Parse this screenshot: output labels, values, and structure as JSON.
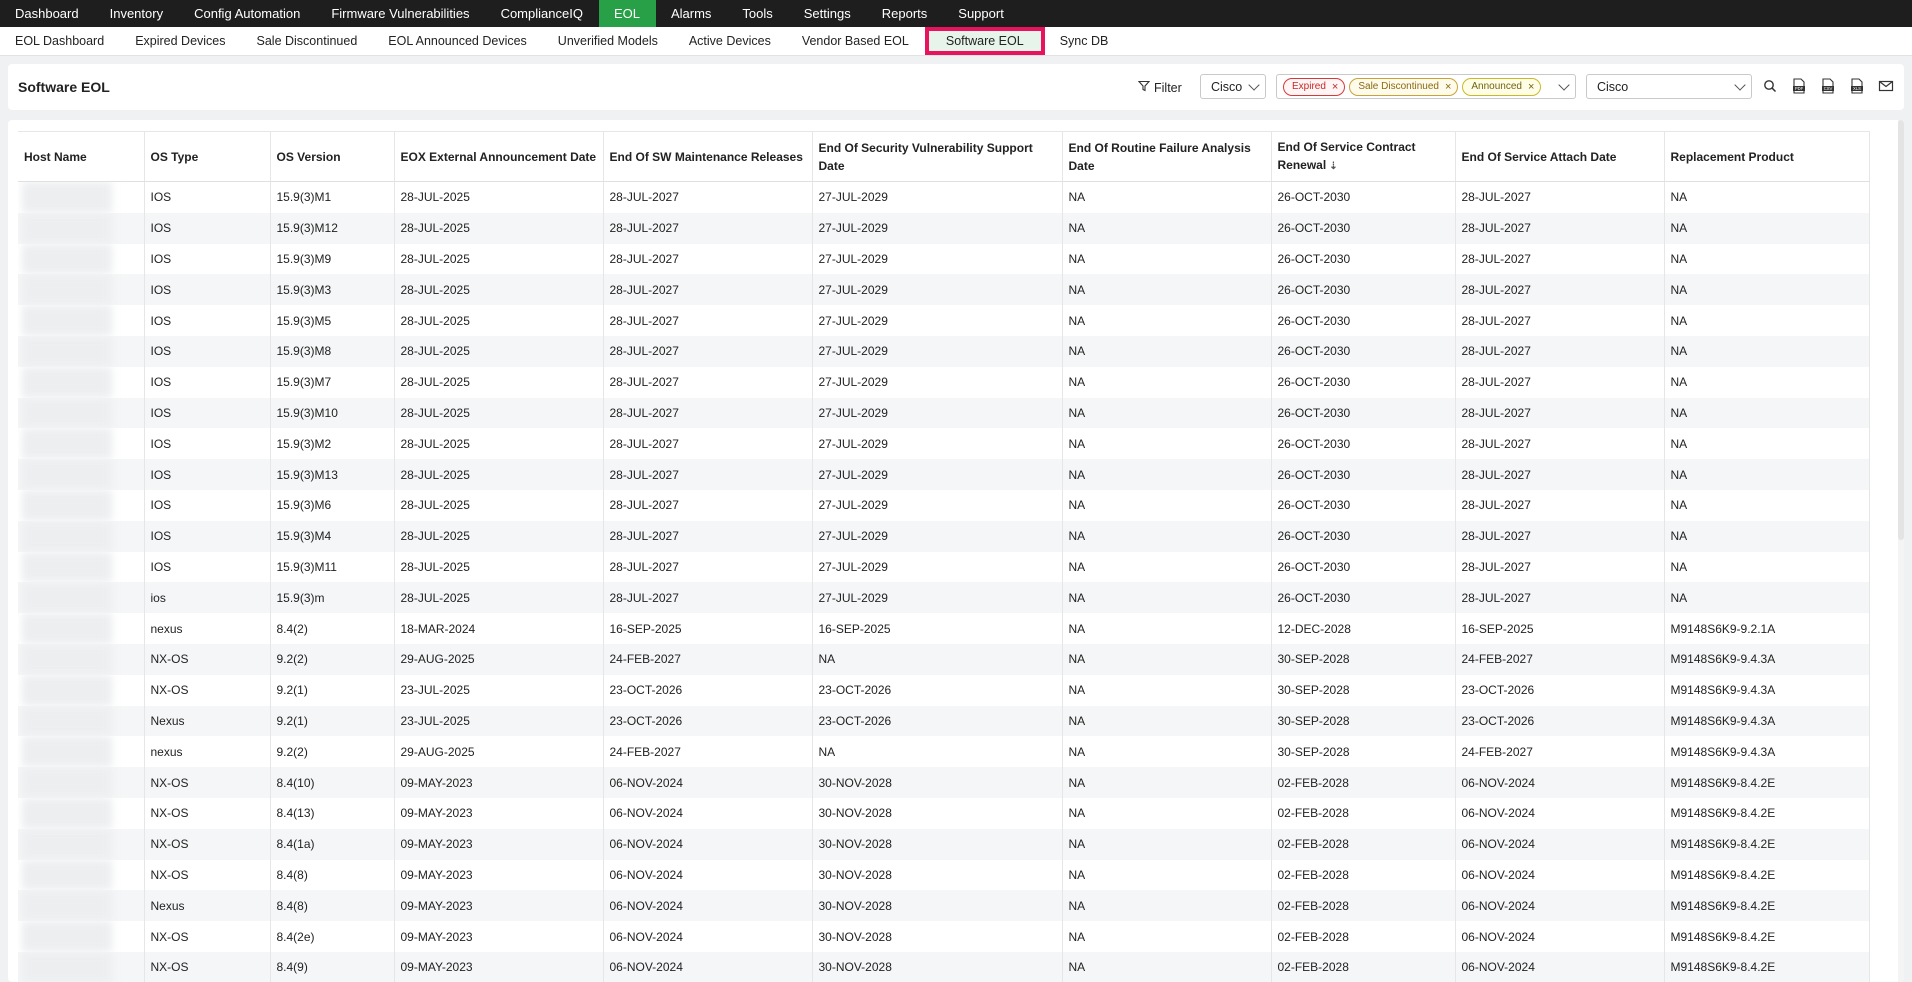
{
  "topnav": {
    "items": [
      "Dashboard",
      "Inventory",
      "Config Automation",
      "Firmware Vulnerabilities",
      "ComplianceIQ",
      "EOL",
      "Alarms",
      "Tools",
      "Settings",
      "Reports",
      "Support"
    ],
    "active": "EOL"
  },
  "subnav": {
    "items": [
      "EOL Dashboard",
      "Expired Devices",
      "Sale Discontinued",
      "EOL Announced Devices",
      "Unverified Models",
      "Active Devices",
      "Vendor Based EOL",
      "Software EOL",
      "Sync DB"
    ],
    "active": "Software EOL"
  },
  "toolbar": {
    "title": "Software EOL",
    "filter_label": "Filter",
    "vendor_value": "Cisco",
    "status_chips": [
      {
        "label": "Expired",
        "color": "#d33b3b"
      },
      {
        "label": "Sale Discontinued",
        "color": "#c9a23a"
      },
      {
        "label": "Announced",
        "color": "#c9b92a"
      }
    ],
    "model_value": "Cisco",
    "icons": [
      "search-icon",
      "pdf-export-icon",
      "csv-export-icon",
      "xls-export-icon",
      "mail-icon"
    ]
  },
  "table": {
    "columns": [
      "Host Name",
      "OS Type",
      "OS Version",
      "EOX External Announcement Date",
      "End Of SW Maintenance Releases",
      "End Of Security Vulnerability Support Date",
      "End Of Routine Failure Analysis Date",
      "End Of Service Contract Renewal",
      "End Of Service Attach Date",
      "Replacement Product"
    ],
    "rows": [
      [
        "",
        "IOS",
        "15.9(3)M1",
        "28-JUL-2025",
        "28-JUL-2027",
        "27-JUL-2029",
        "NA",
        "26-OCT-2030",
        "28-JUL-2027",
        "NA"
      ],
      [
        "",
        "IOS",
        "15.9(3)M12",
        "28-JUL-2025",
        "28-JUL-2027",
        "27-JUL-2029",
        "NA",
        "26-OCT-2030",
        "28-JUL-2027",
        "NA"
      ],
      [
        "",
        "IOS",
        "15.9(3)M9",
        "28-JUL-2025",
        "28-JUL-2027",
        "27-JUL-2029",
        "NA",
        "26-OCT-2030",
        "28-JUL-2027",
        "NA"
      ],
      [
        "",
        "IOS",
        "15.9(3)M3",
        "28-JUL-2025",
        "28-JUL-2027",
        "27-JUL-2029",
        "NA",
        "26-OCT-2030",
        "28-JUL-2027",
        "NA"
      ],
      [
        "",
        "IOS",
        "15.9(3)M5",
        "28-JUL-2025",
        "28-JUL-2027",
        "27-JUL-2029",
        "NA",
        "26-OCT-2030",
        "28-JUL-2027",
        "NA"
      ],
      [
        "",
        "IOS",
        "15.9(3)M8",
        "28-JUL-2025",
        "28-JUL-2027",
        "27-JUL-2029",
        "NA",
        "26-OCT-2030",
        "28-JUL-2027",
        "NA"
      ],
      [
        "",
        "IOS",
        "15.9(3)M7",
        "28-JUL-2025",
        "28-JUL-2027",
        "27-JUL-2029",
        "NA",
        "26-OCT-2030",
        "28-JUL-2027",
        "NA"
      ],
      [
        "",
        "IOS",
        "15.9(3)M10",
        "28-JUL-2025",
        "28-JUL-2027",
        "27-JUL-2029",
        "NA",
        "26-OCT-2030",
        "28-JUL-2027",
        "NA"
      ],
      [
        "",
        "IOS",
        "15.9(3)M2",
        "28-JUL-2025",
        "28-JUL-2027",
        "27-JUL-2029",
        "NA",
        "26-OCT-2030",
        "28-JUL-2027",
        "NA"
      ],
      [
        "",
        "IOS",
        "15.9(3)M13",
        "28-JUL-2025",
        "28-JUL-2027",
        "27-JUL-2029",
        "NA",
        "26-OCT-2030",
        "28-JUL-2027",
        "NA"
      ],
      [
        "",
        "IOS",
        "15.9(3)M6",
        "28-JUL-2025",
        "28-JUL-2027",
        "27-JUL-2029",
        "NA",
        "26-OCT-2030",
        "28-JUL-2027",
        "NA"
      ],
      [
        "",
        "IOS",
        "15.9(3)M4",
        "28-JUL-2025",
        "28-JUL-2027",
        "27-JUL-2029",
        "NA",
        "26-OCT-2030",
        "28-JUL-2027",
        "NA"
      ],
      [
        "",
        "IOS",
        "15.9(3)M11",
        "28-JUL-2025",
        "28-JUL-2027",
        "27-JUL-2029",
        "NA",
        "26-OCT-2030",
        "28-JUL-2027",
        "NA"
      ],
      [
        "",
        "ios",
        "15.9(3)m",
        "28-JUL-2025",
        "28-JUL-2027",
        "27-JUL-2029",
        "NA",
        "26-OCT-2030",
        "28-JUL-2027",
        "NA"
      ],
      [
        "",
        "nexus",
        "8.4(2)",
        "18-MAR-2024",
        "16-SEP-2025",
        "16-SEP-2025",
        "NA",
        "12-DEC-2028",
        "16-SEP-2025",
        "M9148S6K9-9.2.1A"
      ],
      [
        "",
        "NX-OS",
        "9.2(2)",
        "29-AUG-2025",
        "24-FEB-2027",
        "NA",
        "NA",
        "30-SEP-2028",
        "24-FEB-2027",
        "M9148S6K9-9.4.3A"
      ],
      [
        "",
        "NX-OS",
        "9.2(1)",
        "23-JUL-2025",
        "23-OCT-2026",
        "23-OCT-2026",
        "NA",
        "30-SEP-2028",
        "23-OCT-2026",
        "M9148S6K9-9.4.3A"
      ],
      [
        "",
        "Nexus",
        "9.2(1)",
        "23-JUL-2025",
        "23-OCT-2026",
        "23-OCT-2026",
        "NA",
        "30-SEP-2028",
        "23-OCT-2026",
        "M9148S6K9-9.4.3A"
      ],
      [
        "",
        "nexus",
        "9.2(2)",
        "29-AUG-2025",
        "24-FEB-2027",
        "NA",
        "NA",
        "30-SEP-2028",
        "24-FEB-2027",
        "M9148S6K9-9.4.3A"
      ],
      [
        "",
        "NX-OS",
        "8.4(10)",
        "09-MAY-2023",
        "06-NOV-2024",
        "30-NOV-2028",
        "NA",
        "02-FEB-2028",
        "06-NOV-2024",
        "M9148S6K9-8.4.2E"
      ],
      [
        "",
        "NX-OS",
        "8.4(13)",
        "09-MAY-2023",
        "06-NOV-2024",
        "30-NOV-2028",
        "NA",
        "02-FEB-2028",
        "06-NOV-2024",
        "M9148S6K9-8.4.2E"
      ],
      [
        "",
        "NX-OS",
        "8.4(1a)",
        "09-MAY-2023",
        "06-NOV-2024",
        "30-NOV-2028",
        "NA",
        "02-FEB-2028",
        "06-NOV-2024",
        "M9148S6K9-8.4.2E"
      ],
      [
        "",
        "NX-OS",
        "8.4(8)",
        "09-MAY-2023",
        "06-NOV-2024",
        "30-NOV-2028",
        "NA",
        "02-FEB-2028",
        "06-NOV-2024",
        "M9148S6K9-8.4.2E"
      ],
      [
        "",
        "Nexus",
        "8.4(8)",
        "09-MAY-2023",
        "06-NOV-2024",
        "30-NOV-2028",
        "NA",
        "02-FEB-2028",
        "06-NOV-2024",
        "M9148S6K9-8.4.2E"
      ],
      [
        "",
        "NX-OS",
        "8.4(2e)",
        "09-MAY-2023",
        "06-NOV-2024",
        "30-NOV-2028",
        "NA",
        "02-FEB-2028",
        "06-NOV-2024",
        "M9148S6K9-8.4.2E"
      ],
      [
        "",
        "NX-OS",
        "8.4(9)",
        "09-MAY-2023",
        "06-NOV-2024",
        "30-NOV-2028",
        "NA",
        "02-FEB-2028",
        "06-NOV-2024",
        "M9148S6K9-8.4.2E"
      ]
    ]
  }
}
